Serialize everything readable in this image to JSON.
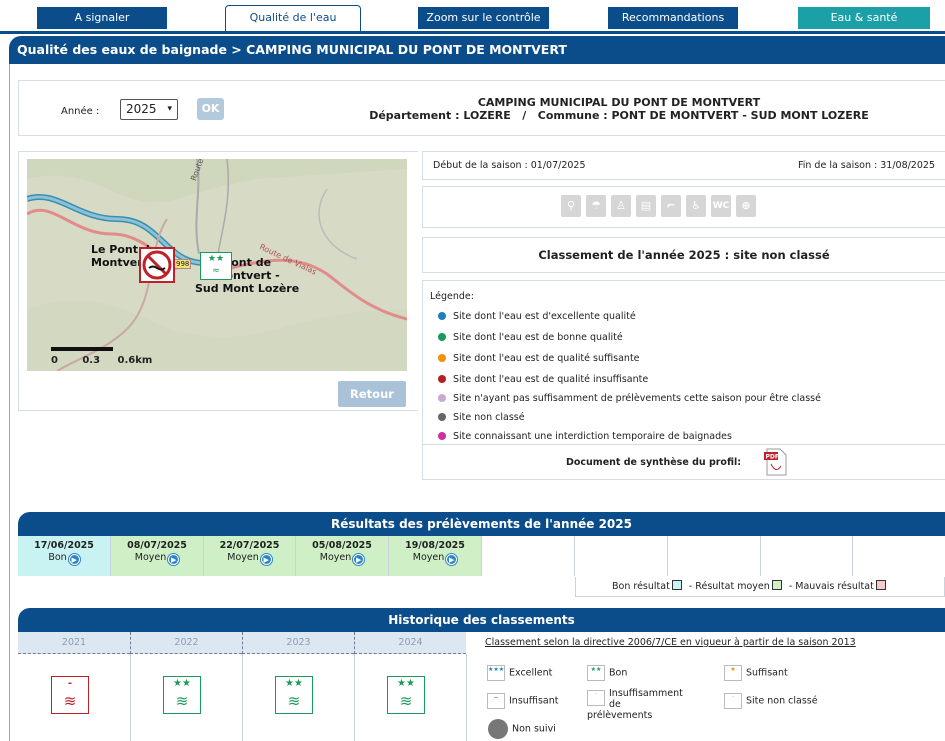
{
  "tabs": [
    {
      "label": "A signaler"
    },
    {
      "label": "Qualité de l'eau"
    },
    {
      "label": "Zoom sur le contrôle"
    },
    {
      "label": "Recommandations"
    },
    {
      "label": "Eau & santé"
    }
  ],
  "title": "Qualité des eaux de baignade > CAMPING MUNICIPAL DU PONT DE MONTVERT",
  "year_selector": {
    "label": "Année :",
    "value": "2025",
    "ok": "OK"
  },
  "site": {
    "name": "CAMPING MUNICIPAL DU PONT DE MONTVERT",
    "location": "Département : LOZERE   /   Commune : PONT DE MONTVERT - SUD MONT LOZERE"
  },
  "map": {
    "labels": {
      "town1a": "Le Pont de",
      "town1b": "Montvert",
      "town2a": "Pont de",
      "town2b": "Montvert -",
      "town2c": "Sud Mont Lozère",
      "road1": "Route de Finiels",
      "road2": "Route de Vialas",
      "road_num": "998"
    },
    "scale": {
      "s0": "0",
      "s1": "0.3",
      "s2": "0.6km"
    },
    "retour": "Retour"
  },
  "season": {
    "start": "Début de la saison :  01/07/2025",
    "end": "Fin de la saison :  31/08/2025"
  },
  "facility_icons": [
    "binoculars-icon",
    "parasol-icon",
    "lifeguard-icon",
    "info-board-icon",
    "shower-icon",
    "accessibility-icon",
    "wc-icon",
    "first-aid-icon"
  ],
  "classification": "Classement de l'année 2025 : site non classé",
  "legend": {
    "header": "Légende:",
    "items": [
      {
        "text": "Site dont l'eau est d'excellente qualité",
        "color": "#1e7fc0"
      },
      {
        "text": "Site dont l'eau est de bonne qualité",
        "color": "#1a9a5a"
      },
      {
        "text": "Site dont l'eau est de qualité suffisante",
        "color": "#f29000"
      },
      {
        "text": "Site dont l'eau est de qualité insuffisante",
        "color": "#b22222"
      },
      {
        "text": "Site n'ayant pas suffisamment de prélèvements cette saison pour être classé",
        "color": "#c9a8d6"
      },
      {
        "text": "Site non classé",
        "color": "#666666"
      },
      {
        "text": "Site connaissant une interdiction temporaire de baignades",
        "color": "#d0309c"
      }
    ]
  },
  "synthesis": "Document de synthèse du profil:",
  "results": {
    "title": "Résultats des prélèvements de l'année 2025",
    "samples": [
      {
        "date": "17/06/2025",
        "status": "Bon"
      },
      {
        "date": "08/07/2025",
        "status": "Moyen"
      },
      {
        "date": "22/07/2025",
        "status": "Moyen"
      },
      {
        "date": "05/08/2025",
        "status": "Moyen"
      },
      {
        "date": "19/08/2025",
        "status": "Moyen"
      }
    ],
    "legend": {
      "bon": "Bon résultat",
      "moyen": "Résultat moyen",
      "mauvais": "Mauvais résultat",
      "sep": "-"
    }
  },
  "history": {
    "title": "Historique des classements",
    "years": [
      "2021",
      "2022",
      "2023",
      "2024"
    ],
    "directive": "Classement selon la directive 2006/7/CE en vigueur à partir de la saison 2013",
    "legend": {
      "excellent": "Excellent",
      "bon": "Bon",
      "suffisant": "Suffisant",
      "insuffisant": "Insuffisant",
      "insuf_prel_1": "Insuffisamment",
      "insuf_prel_2": "de prélèvements",
      "non_classe": "Site non classé",
      "non_suivi": "Non suivi"
    },
    "badges": [
      "-",
      "★★",
      "★★",
      "★★"
    ]
  }
}
